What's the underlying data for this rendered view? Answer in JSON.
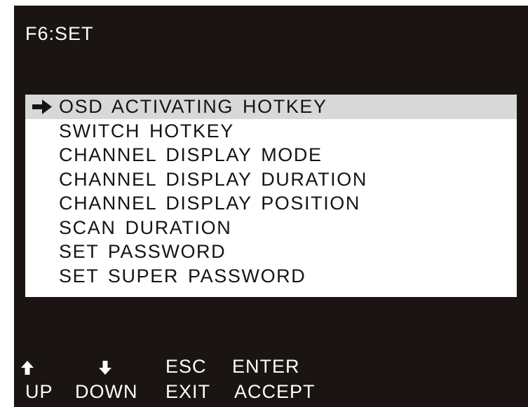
{
  "title": "F6:SET",
  "menu": {
    "pointer_icon": "right-arrow-icon",
    "items": [
      {
        "label": "OSD ACTIVATING HOTKEY",
        "selected": true
      },
      {
        "label": "SWITCH HOTKEY",
        "selected": false
      },
      {
        "label": "CHANNEL  DISPLAY MODE",
        "selected": false
      },
      {
        "label": "CHANNEL  DISPLAY DURATION",
        "selected": false
      },
      {
        "label": "CHANNEL  DISPLAY POSITION",
        "selected": false
      },
      {
        "label": "SCAN DURATION",
        "selected": false
      },
      {
        "label": "SET PASSWORD",
        "selected": false
      },
      {
        "label": "SET SUPER PASSWORD",
        "selected": false
      }
    ]
  },
  "hints": {
    "up": {
      "icon": "up-arrow-icon",
      "action": "UP"
    },
    "down": {
      "icon": "down-arrow-icon",
      "action": "DOWN"
    },
    "esc": {
      "key": "ESC",
      "action": "EXIT"
    },
    "enter": {
      "key": "ENTER",
      "action": "ACCEPT"
    }
  },
  "colors": {
    "screen_background": "#1a1513",
    "screen_text": "#ffffff",
    "menu_background": "#ffffff",
    "menu_text": "#141414",
    "selection_highlight": "#d8d8d8"
  }
}
